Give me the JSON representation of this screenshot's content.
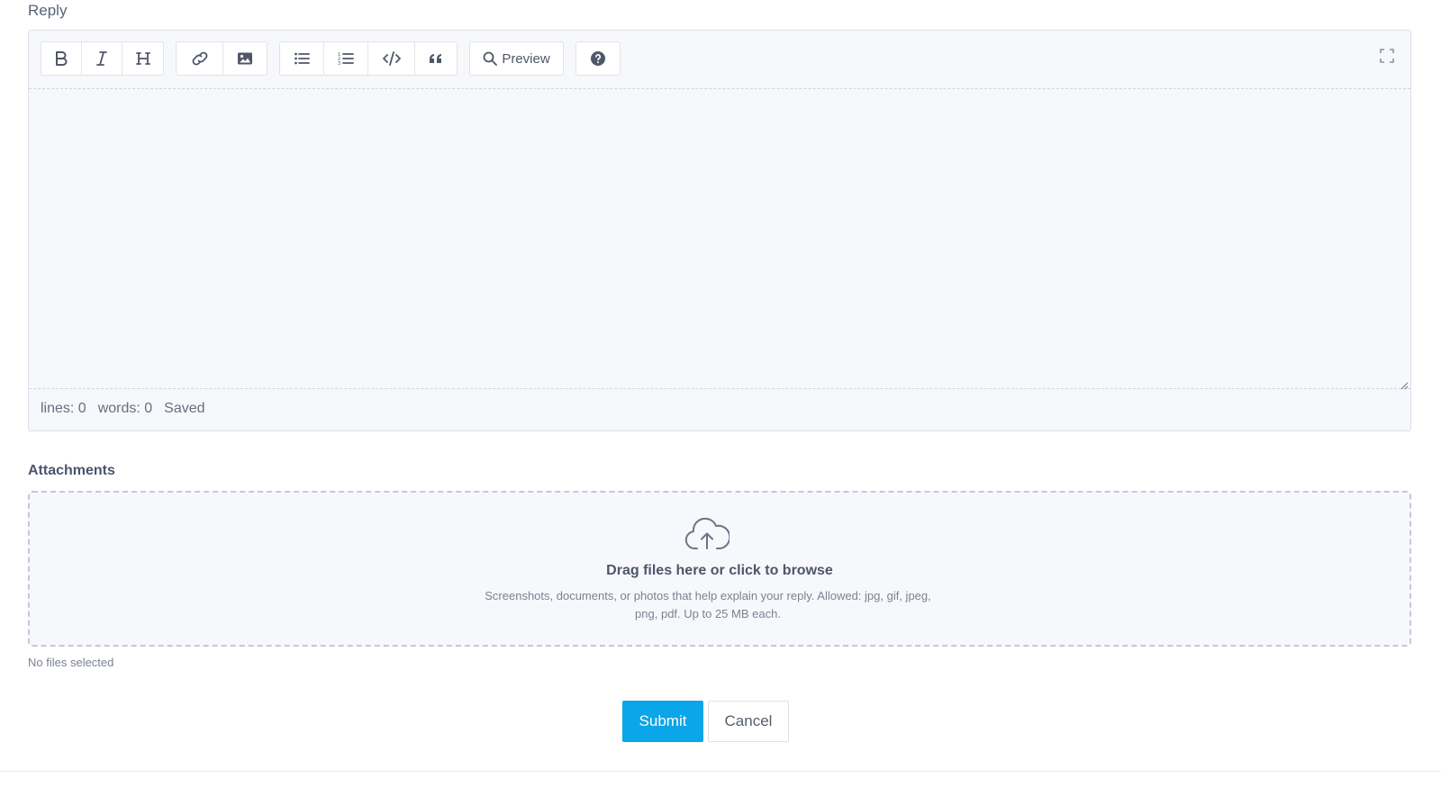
{
  "reply": {
    "label": "Reply"
  },
  "toolbar": {
    "buttons": {
      "bold": "bold-icon",
      "italic": "italic-icon",
      "heading": "heading-icon",
      "link": "link-icon",
      "image": "image-icon",
      "unordered_list": "bullet-list-icon",
      "ordered_list": "numbered-list-icon",
      "code": "code-icon",
      "quote": "quote-icon",
      "preview": "search-icon",
      "help": "help-icon",
      "fullscreen": "fullscreen-icon"
    },
    "preview_label": "Preview"
  },
  "editor": {
    "value": ""
  },
  "status": {
    "lines": "lines: 0",
    "words": "words: 0",
    "saved": "Saved"
  },
  "attachments": {
    "title": "Attachments",
    "drop_title": "Drag files here or click to browse",
    "drop_desc": "Screenshots, documents, or photos that help explain your reply. Allowed: jpg, gif, jpeg, png, pdf. Up to 25 MB each.",
    "no_files": "No files selected",
    "icon": "cloud-upload-icon"
  },
  "actions": {
    "submit_label": "Submit",
    "cancel_label": "Cancel"
  },
  "colors": {
    "primary": "#0ba5e9",
    "editor_bg": "#f7f8fb",
    "border": "#dde1e8"
  }
}
